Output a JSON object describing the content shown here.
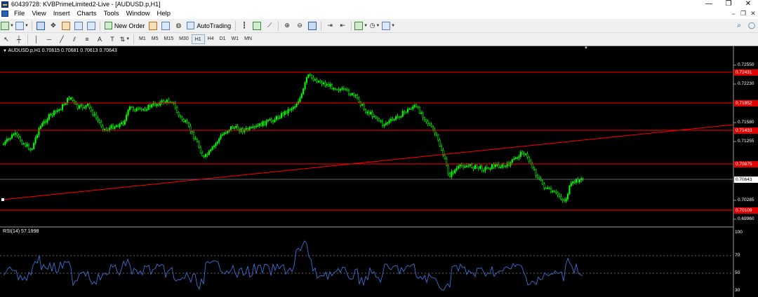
{
  "window": {
    "title": "60439728: KVBPrimeLimited2-Live - [AUDUSD.p,H1]",
    "minimize": "—",
    "maximize": "❐",
    "close": "✕"
  },
  "menu": {
    "items": [
      "File",
      "View",
      "Insert",
      "Charts",
      "Tools",
      "Window",
      "Help"
    ],
    "mdi_minimize": "−",
    "mdi_restore": "❐",
    "mdi_close": "✕"
  },
  "toolbar": {
    "new_order": "New Order",
    "autotrading": "AutoTrading",
    "text_tool": "A",
    "label_tool": "T",
    "timeframes": [
      "M1",
      "M5",
      "M15",
      "M30",
      "H1",
      "H4",
      "D1",
      "W1",
      "MN"
    ],
    "active_timeframe": "H1"
  },
  "chart": {
    "symbol_info": "AUDUSD.p,H1  0.70615 0.70681 0.70613 0.70643",
    "price_labels": [
      "0.72550",
      "0.72230",
      "0.71580",
      "0.71255",
      "0.70285",
      "0.69960"
    ],
    "red_tags": [
      "0.72431",
      "0.71852",
      "0.71433",
      "0.70875",
      "0.70109"
    ],
    "current_price": "0.70643",
    "colors": {
      "candles": "#00ff00",
      "levels": "#ff0000",
      "rsi": "#3f6fd0",
      "background": "#000000"
    }
  },
  "rsi": {
    "label": "RSI(14) 57.1998",
    "scale": [
      "100",
      "70",
      "50",
      "30"
    ]
  }
}
